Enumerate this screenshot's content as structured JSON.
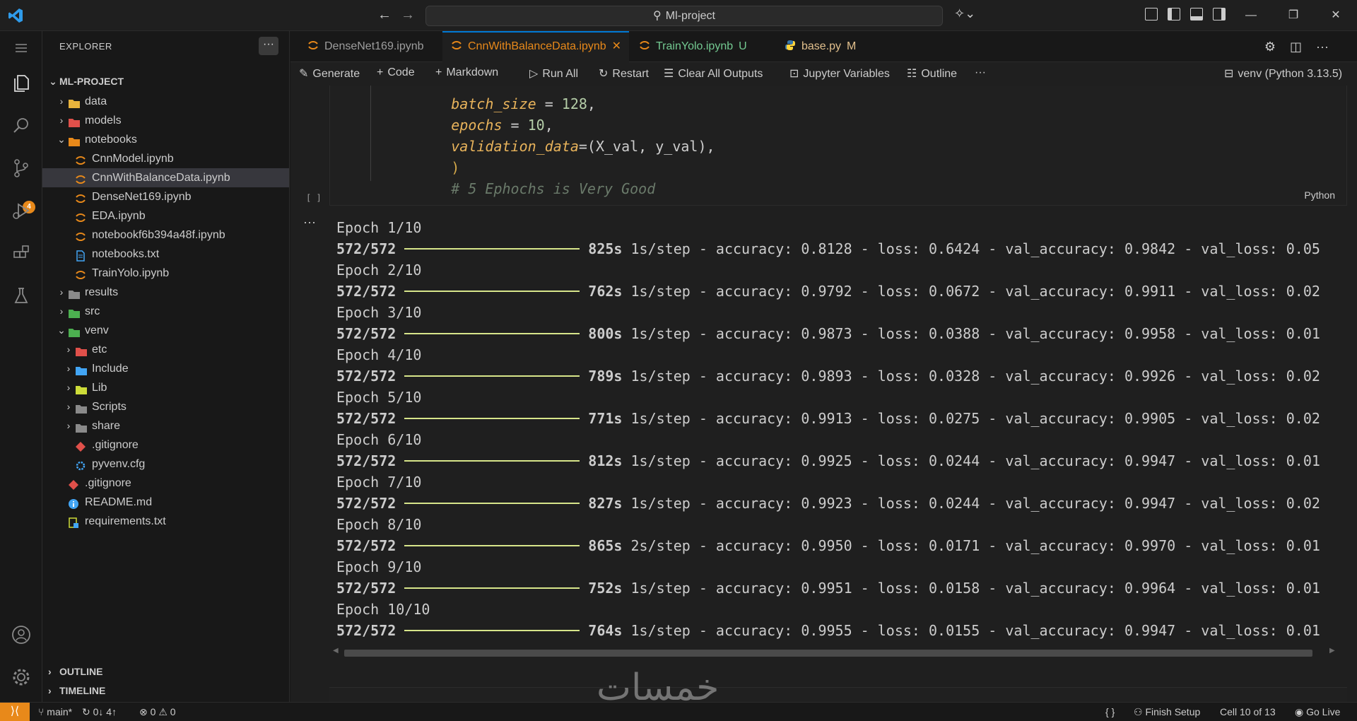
{
  "titlebar": {
    "search_text": "Ml-project"
  },
  "explorer": {
    "title": "EXPLORER",
    "root": "ML-PROJECT",
    "items": [
      {
        "label": "data",
        "kind": "folder",
        "color": "#e8b33c"
      },
      {
        "label": "models",
        "kind": "folder",
        "color": "#e0504a"
      },
      {
        "label": "notebooks",
        "kind": "folder-open",
        "color": "#e8891a"
      },
      {
        "label": "CnnModel.ipynb",
        "kind": "jupyter"
      },
      {
        "label": "CnnWithBalanceData.ipynb",
        "kind": "jupyter",
        "selected": true
      },
      {
        "label": "DenseNet169.ipynb",
        "kind": "jupyter"
      },
      {
        "label": "EDA.ipynb",
        "kind": "jupyter"
      },
      {
        "label": "notebookf6b394a48f.ipynb",
        "kind": "jupyter"
      },
      {
        "label": "notebooks.txt",
        "kind": "text"
      },
      {
        "label": "TrainYolo.ipynb",
        "kind": "jupyter"
      },
      {
        "label": "results",
        "kind": "folder",
        "color": "#8a8a8a"
      },
      {
        "label": "src",
        "kind": "folder",
        "color": "#4caf50"
      },
      {
        "label": "venv",
        "kind": "folder-open",
        "color": "#4caf50"
      },
      {
        "label": "etc",
        "kind": "folder",
        "color": "#e0504a"
      },
      {
        "label": "Include",
        "kind": "folder",
        "color": "#42a5f5"
      },
      {
        "label": "Lib",
        "kind": "folder",
        "color": "#cddc39"
      },
      {
        "label": "Scripts",
        "kind": "folder",
        "color": "#8a8a8a"
      },
      {
        "label": "share",
        "kind": "folder",
        "color": "#8a8a8a"
      },
      {
        "label": ".gitignore",
        "kind": "git"
      },
      {
        "label": "pyvenv.cfg",
        "kind": "gear"
      },
      {
        "label": ".gitignore",
        "kind": "git"
      },
      {
        "label": "README.md",
        "kind": "info"
      },
      {
        "label": "requirements.txt",
        "kind": "reqs"
      }
    ],
    "sections": [
      "OUTLINE",
      "TIMELINE"
    ]
  },
  "activity": {
    "scm_badge": "4"
  },
  "tabs": [
    {
      "label": "DenseNet169.ipynb",
      "mark": ""
    },
    {
      "label": "CnnWithBalanceData.ipynb",
      "mark": "✕"
    },
    {
      "label": "TrainYolo.ipynb",
      "mark": "U"
    },
    {
      "label": "base.py",
      "mark": "M"
    }
  ],
  "toolbar": {
    "generate": "Generate",
    "code": "Code",
    "markdown": "Markdown",
    "run_all": "Run All",
    "restart": "Restart",
    "clear": "Clear All Outputs",
    "variables": "Jupyter Variables",
    "outline": "Outline",
    "more": "···",
    "kernel": "venv (Python 3.13.5)"
  },
  "code": {
    "line1_name": "batch_size",
    "line1_eq": " = ",
    "line1_val": "128",
    "line1_tail": ",",
    "line2_name": "epochs",
    "line2_eq": " = ",
    "line2_val": "10",
    "line2_tail": ",",
    "line3_name": "validation_data",
    "line3_rest": "=(X_val, y_val),",
    "line4": ")",
    "line5": "# 5 Ephochs is Very Good",
    "language": "Python",
    "run_marker": "[ ]"
  },
  "output": {
    "total": "572/572",
    "epochs": [
      {
        "epoch": "Epoch 1/10",
        "time": "825s",
        "step": "1s/step",
        "accuracy": "0.8128",
        "loss": "0.6424",
        "val_accuracy": "0.9842",
        "val_loss": "0.05"
      },
      {
        "epoch": "Epoch 2/10",
        "time": "762s",
        "step": "1s/step",
        "accuracy": "0.9792",
        "loss": "0.0672",
        "val_accuracy": "0.9911",
        "val_loss": "0.02"
      },
      {
        "epoch": "Epoch 3/10",
        "time": "800s",
        "step": "1s/step",
        "accuracy": "0.9873",
        "loss": "0.0388",
        "val_accuracy": "0.9958",
        "val_loss": "0.01"
      },
      {
        "epoch": "Epoch 4/10",
        "time": "789s",
        "step": "1s/step",
        "accuracy": "0.9893",
        "loss": "0.0328",
        "val_accuracy": "0.9926",
        "val_loss": "0.02"
      },
      {
        "epoch": "Epoch 5/10",
        "time": "771s",
        "step": "1s/step",
        "accuracy": "0.9913",
        "loss": "0.0275",
        "val_accuracy": "0.9905",
        "val_loss": "0.02"
      },
      {
        "epoch": "Epoch 6/10",
        "time": "812s",
        "step": "1s/step",
        "accuracy": "0.9925",
        "loss": "0.0244",
        "val_accuracy": "0.9947",
        "val_loss": "0.01"
      },
      {
        "epoch": "Epoch 7/10",
        "time": "827s",
        "step": "1s/step",
        "accuracy": "0.9923",
        "loss": "0.0244",
        "val_accuracy": "0.9947",
        "val_loss": "0.02"
      },
      {
        "epoch": "Epoch 8/10",
        "time": "865s",
        "step": "2s/step",
        "accuracy": "0.9950",
        "loss": "0.0171",
        "val_accuracy": "0.9970",
        "val_loss": "0.01"
      },
      {
        "epoch": "Epoch 9/10",
        "time": "752s",
        "step": "1s/step",
        "accuracy": "0.9951",
        "loss": "0.0158",
        "val_accuracy": "0.9964",
        "val_loss": "0.01"
      },
      {
        "epoch": "Epoch 10/10",
        "time": "764s",
        "step": "1s/step",
        "accuracy": "0.9955",
        "loss": "0.0155",
        "val_accuracy": "0.9947",
        "val_loss": "0.01"
      }
    ]
  },
  "watermark": "خمسات",
  "statusbar": {
    "branch": "main*",
    "sync": "0↓ 4↑",
    "errors": "0",
    "warnings": "0",
    "braces": "{ }",
    "finish_setup": "Finish Setup",
    "cell": "Cell 10 of 13",
    "go_live": "Go Live"
  },
  "colors": {
    "accent": "#0078d4",
    "jupyter": "#e8891a",
    "progress": "#d7e58a"
  }
}
